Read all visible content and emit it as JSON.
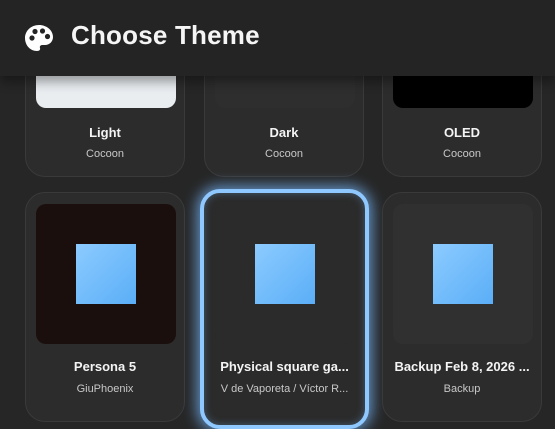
{
  "header": {
    "title": "Choose Theme",
    "icon": "palette-icon"
  },
  "themes": [
    {
      "name": "Light",
      "author": "Cocoon",
      "preview_color": "#e9edf0"
    },
    {
      "name": "Dark",
      "author": "Cocoon",
      "preview_color": "#2e2e2e"
    },
    {
      "name": "OLED",
      "author": "Cocoon",
      "preview_color": "#000000"
    },
    {
      "name": "Persona 5",
      "author": "GiuPhoenix",
      "preview_color": "#1a0f0d"
    },
    {
      "name": "Physical square ga...",
      "author": "V de Vaporeta / Víctor R...",
      "preview_color": "#2b2b2b",
      "selected": true
    },
    {
      "name": "Backup Feb 8, 2026 ...",
      "author": "Backup",
      "preview_color": "#303030"
    }
  ],
  "colors": {
    "background": "#262626",
    "accent": "#8fc8ff",
    "preview_square": "#6bb8ff"
  }
}
